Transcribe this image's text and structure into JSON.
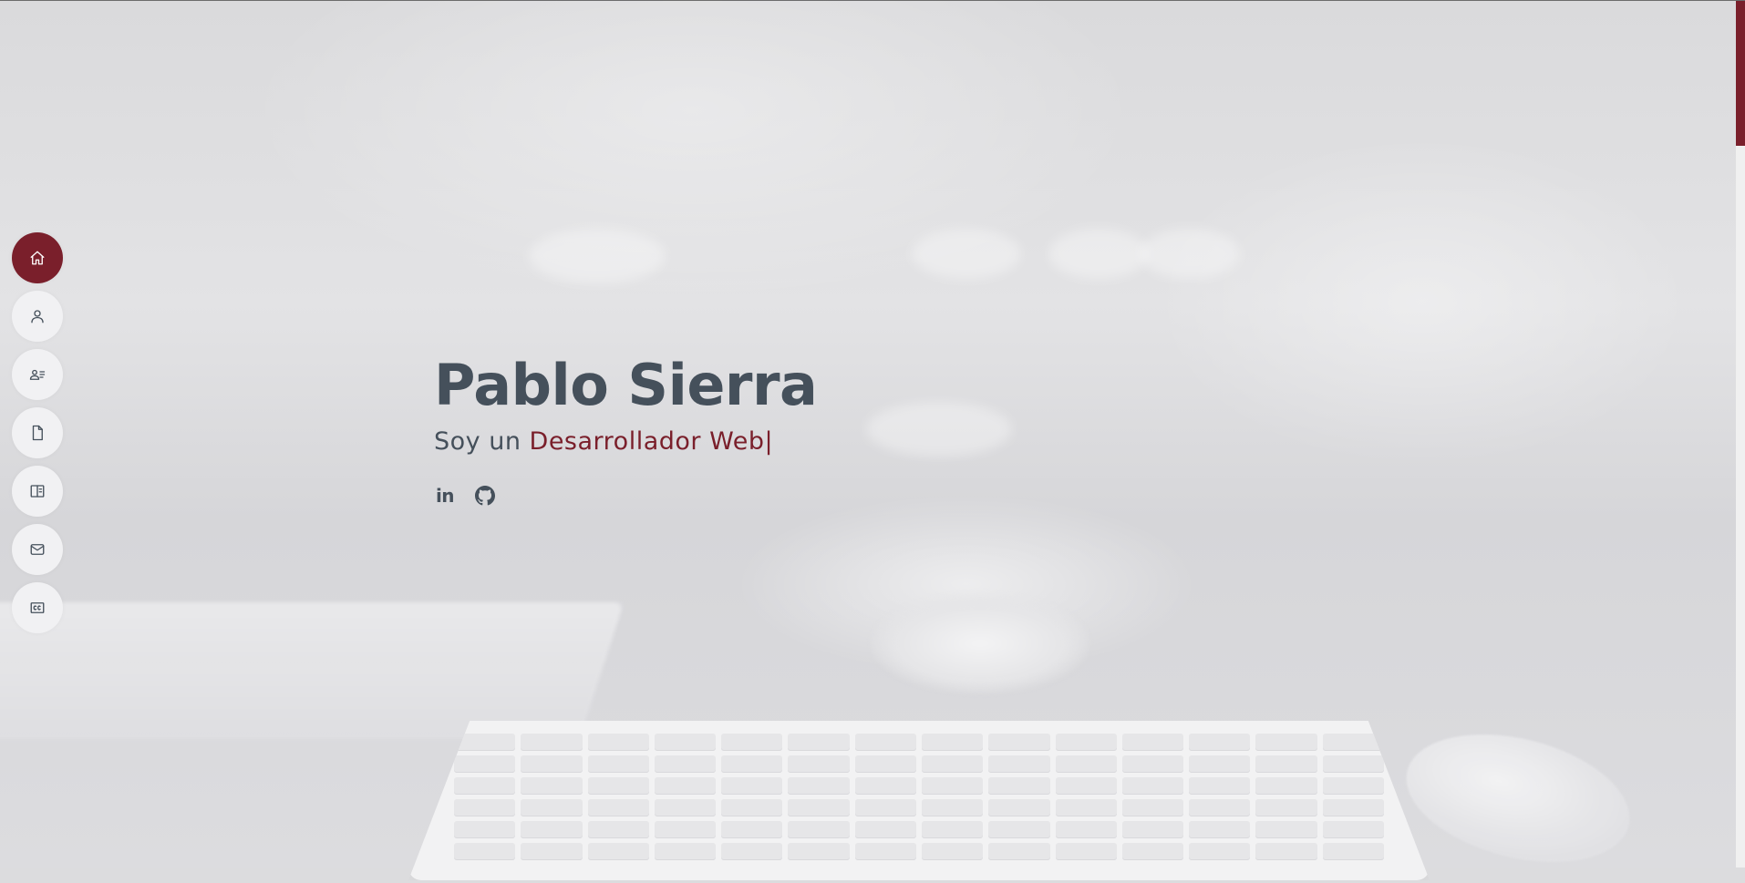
{
  "hero": {
    "name": "Pablo Sierra",
    "intro": "Soy un ",
    "typed_role": "Desarrollador Web",
    "caret": "|"
  },
  "nav": {
    "items": [
      {
        "icon": "home-icon",
        "active": true
      },
      {
        "icon": "user-icon",
        "active": false
      },
      {
        "icon": "resume-icon",
        "active": false
      },
      {
        "icon": "file-icon",
        "active": false
      },
      {
        "icon": "book-icon",
        "active": false
      },
      {
        "icon": "envelope-icon",
        "active": false
      },
      {
        "icon": "card-icon",
        "active": false
      }
    ]
  },
  "social": {
    "linkedin_label": "in",
    "github_icon": "github-icon"
  },
  "colors": {
    "accent": "#7a1f2b",
    "text": "#45505b",
    "nav_bg": "#f1f1f3"
  }
}
